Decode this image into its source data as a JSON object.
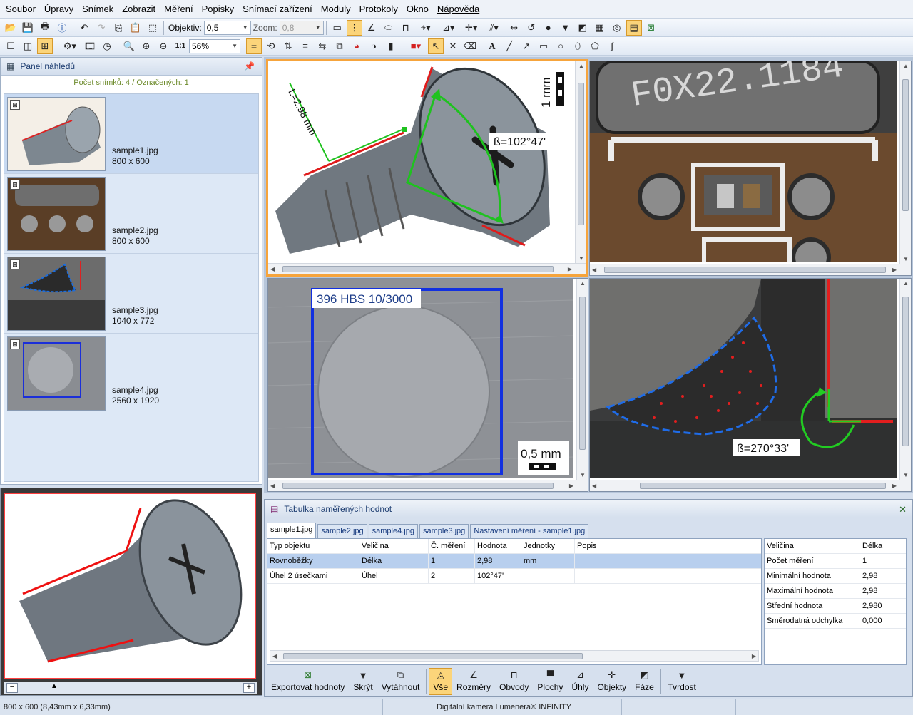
{
  "menu": [
    "Soubor",
    "Úpravy",
    "Snímek",
    "Zobrazit",
    "Měření",
    "Popisky",
    "Snímací zařízení",
    "Moduly",
    "Protokoly",
    "Okno",
    "Nápověda"
  ],
  "toolbar": {
    "objective_label": "Objektiv:",
    "objective_value": "0,5",
    "zoom_label": "Zoom:",
    "zoom_value": "0,8",
    "zoom_percent": "56%"
  },
  "preview_panel": {
    "title": "Panel náhledů",
    "info": "Počet snímků: 4 / Označených: 1",
    "items": [
      {
        "name": "sample1.jpg",
        "size": "800 x 600"
      },
      {
        "name": "sample2.jpg",
        "size": "800 x 600"
      },
      {
        "name": "sample3.jpg",
        "size": "1040 x 772"
      },
      {
        "name": "sample4.jpg",
        "size": "2560 x 1920"
      }
    ]
  },
  "views": {
    "screw": {
      "length_label": "L=2,98 mm",
      "angle_label": "ß=102°47'",
      "scale_label": "1 mm"
    },
    "chip": {
      "text": "F0X22.1184"
    },
    "hardness": {
      "label": "396 HBS 10/3000",
      "scale_label": "0,5 mm"
    },
    "weld": {
      "angle_label": "ß=270°33'"
    }
  },
  "table_panel": {
    "title": "Tabulka naměřených hodnot",
    "tabs": [
      "sample1.jpg",
      "sample2.jpg",
      "sample4.jpg",
      "sample3.jpg",
      "Nastavení měření - sample1.jpg"
    ],
    "columns": [
      "Typ objektu",
      "Veličina",
      "Č. měření",
      "Hodnota",
      "Jednotky",
      "Popis"
    ],
    "rows": [
      [
        "Rovnoběžky",
        "Délka",
        "1",
        "2,98",
        "mm",
        ""
      ],
      [
        "Úhel 2 úsečkami",
        "Úhel",
        "2",
        "102°47'",
        "",
        ""
      ]
    ],
    "stats_header": [
      "Veličina",
      "Délka"
    ],
    "stats": [
      [
        "Počet měření",
        "1"
      ],
      [
        "Minimální hodnota",
        "2,98"
      ],
      [
        "Maximální hodnota",
        "2,98"
      ],
      [
        "Střední hodnota",
        "2,980"
      ],
      [
        "Směrodatná odchylka",
        "0,000"
      ]
    ],
    "actions": [
      "Exportovat hodnoty",
      "Skrýt",
      "Vytáhnout",
      "Vše",
      "Rozměry",
      "Obvody",
      "Plochy",
      "Úhly",
      "Objekty",
      "Fáze",
      "Tvrdost"
    ]
  },
  "status": {
    "image_info": "800 x 600 (8,43mm x 6,33mm)",
    "camera": "Digitální kamera Lumenera® INFINITY"
  }
}
